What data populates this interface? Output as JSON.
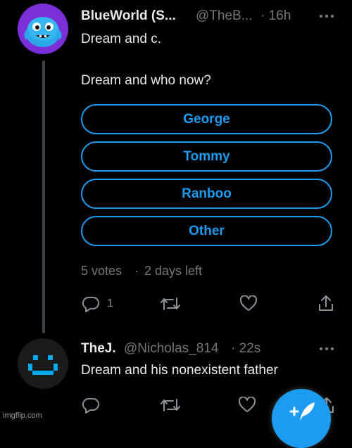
{
  "tweet": {
    "display_name": "BlueWorld (S...",
    "handle": "@TheB...",
    "time": "· 16h",
    "text_line1": "Dream and c.",
    "text_line2": "Dream and who now?",
    "poll": {
      "options": [
        "George",
        "Tommy",
        "Ranboo",
        "Other"
      ],
      "votes_text": "5 votes",
      "separator": "·",
      "time_left": "2 days left"
    },
    "reply_count": "1"
  },
  "reply": {
    "display_name": "TheJ.",
    "handle": "@Nicholas_814",
    "time": "· 22s",
    "text": "Dream and his nonexistent father"
  },
  "icons": {
    "more": "more-horizontal-icon",
    "reply": "reply-bubble-icon",
    "retweet": "retweet-icon",
    "like": "heart-icon",
    "share": "share-icon",
    "compose": "compose-feather-icon"
  },
  "watermark": "imgflip.com",
  "colors": {
    "accent": "#1d9bf0",
    "background": "#000000",
    "text": "#e7e9ea",
    "muted": "#71767b"
  }
}
